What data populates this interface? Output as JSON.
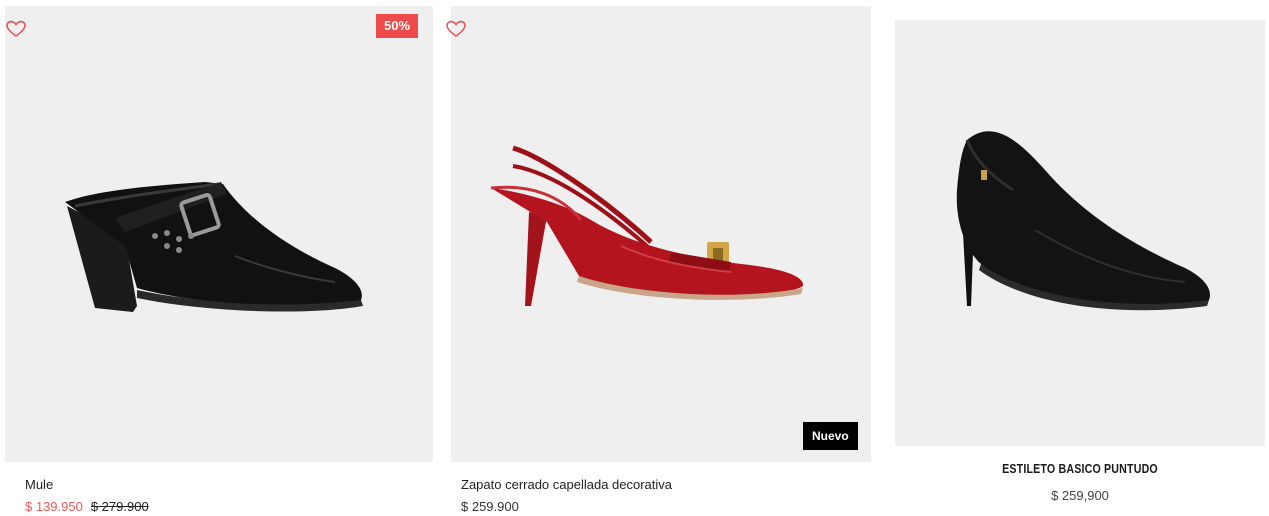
{
  "products": [
    {
      "name": "Mule",
      "sale_price": "$ 139.950",
      "original_price": "$ 279.900",
      "discount_badge": "50%",
      "image_icon": "black-mule-shoe-image",
      "favorite_icon": "heart-outline-icon"
    },
    {
      "name": "Zapato cerrado capellada decorativa",
      "price": "$ 259.900",
      "new_badge": "Nuevo",
      "image_icon": "red-slingback-pump-image",
      "favorite_icon": "heart-outline-icon"
    },
    {
      "name": "ESTILETO BASICO PUNTUDO",
      "price": "$ 259,900",
      "image_icon": "black-stiletto-pump-image"
    }
  ],
  "colors": {
    "sale": "#f04b4b",
    "heart": "#e8484d",
    "badge_new_bg": "#000000",
    "image_bg": "#efefef"
  }
}
